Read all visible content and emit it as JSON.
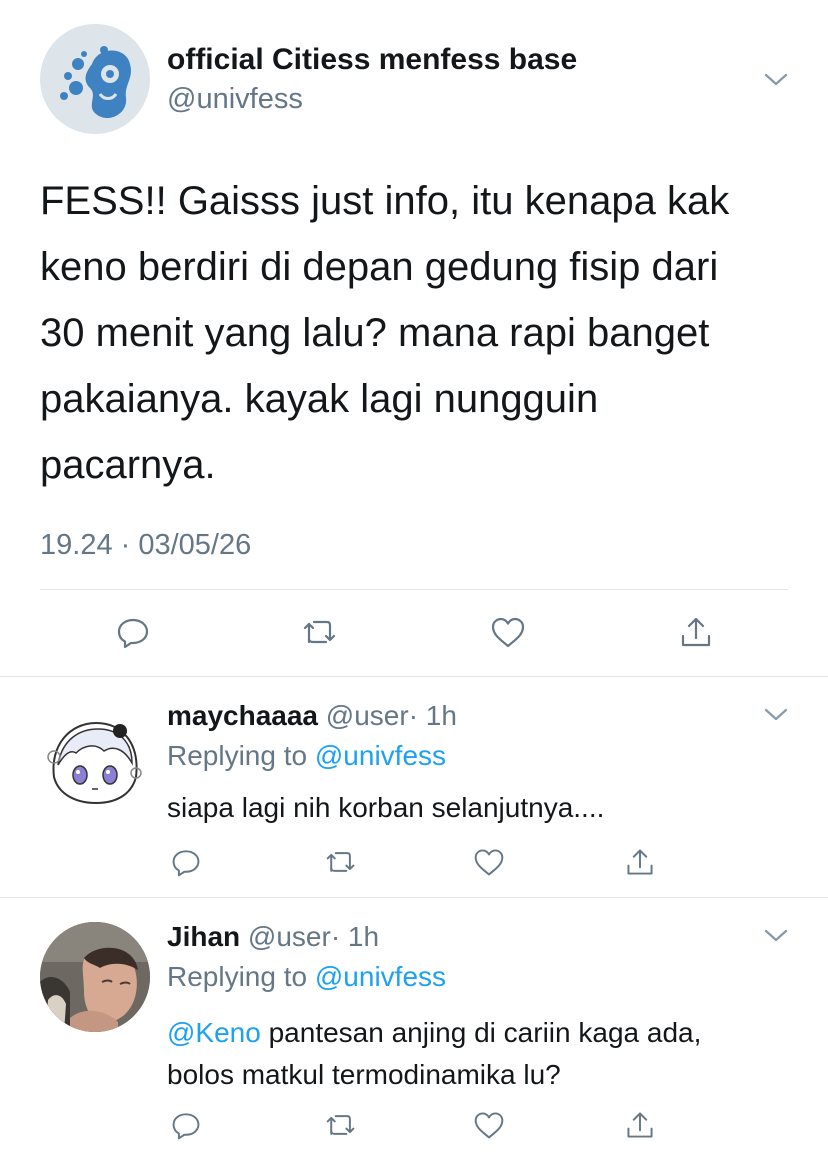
{
  "main_tweet": {
    "display_name": "official Citiess menfess base",
    "handle": "@univfess",
    "text_lines": [
      "FESS!! Gaisss just info, itu kenapa kak",
      "keno berdiri di depan gedung fisip dari",
      "30 menit yang lalu? mana rapi banget",
      "pakaianya. kayak lagi nungguin",
      "pacarnya."
    ],
    "timestamp": "19.24 · 03/05/26"
  },
  "replies": [
    {
      "display_name": "maychaaaa",
      "handle": "@user",
      "time": "· 1h",
      "replying_prefix": "Replying to",
      "replying_to": "@univfess",
      "text_lines": [
        "siapa lagi nih korban selanjutnya...."
      ]
    },
    {
      "display_name": "Jihan",
      "handle": "@user",
      "time": "· 1h",
      "replying_prefix": "Replying to",
      "replying_to": "@univfess",
      "mention": "@Keno",
      "text_line1_rest": " pantesan anjing di cariin kaga ada,",
      "text_line2": "bolos matkul termodinamika lu?"
    }
  ],
  "icons": [
    "chevron-down-icon",
    "reply-icon",
    "retweet-icon",
    "like-icon",
    "share-icon"
  ],
  "colors": {
    "link": "#1da1f2",
    "muted": "#657786",
    "text": "#14171a",
    "divider": "#e1e8ed"
  }
}
